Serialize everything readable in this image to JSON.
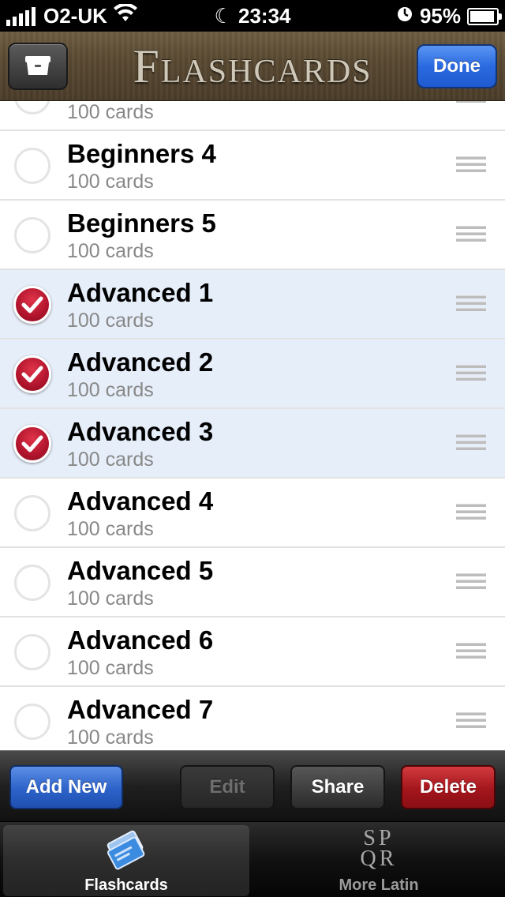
{
  "status_bar": {
    "carrier": "O2-UK",
    "time": "23:34",
    "battery": "95%",
    "battery_level": 0.95
  },
  "nav": {
    "title": "Flashcards",
    "done_label": "Done"
  },
  "list": {
    "rows": [
      {
        "title": "",
        "subtitle": "100 cards",
        "selected": false
      },
      {
        "title": "Beginners 4",
        "subtitle": "100 cards",
        "selected": false
      },
      {
        "title": "Beginners 5",
        "subtitle": "100 cards",
        "selected": false
      },
      {
        "title": "Advanced 1",
        "subtitle": "100 cards",
        "selected": true
      },
      {
        "title": "Advanced 2",
        "subtitle": "100 cards",
        "selected": true
      },
      {
        "title": "Advanced 3",
        "subtitle": "100 cards",
        "selected": true
      },
      {
        "title": "Advanced 4",
        "subtitle": "100 cards",
        "selected": false
      },
      {
        "title": "Advanced 5",
        "subtitle": "100 cards",
        "selected": false
      },
      {
        "title": "Advanced 6",
        "subtitle": "100 cards",
        "selected": false
      },
      {
        "title": "Advanced 7",
        "subtitle": "100 cards",
        "selected": false
      }
    ]
  },
  "toolbar": {
    "add_label": "Add New",
    "edit_label": "Edit",
    "share_label": "Share",
    "delete_label": "Delete"
  },
  "tabs": [
    {
      "label": "Flashcards",
      "icon": "cards-icon",
      "active": true
    },
    {
      "label": "More Latin",
      "icon": "spqr-icon",
      "active": false,
      "icon_text": [
        "SP",
        "QR"
      ]
    }
  ],
  "colors": {
    "accent_blue": "#2a6ae0",
    "delete_red": "#a3161c",
    "check_red": "#b0142c",
    "selected_row": "#e6eef9"
  }
}
